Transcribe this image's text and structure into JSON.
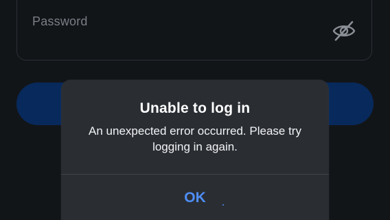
{
  "login_form": {
    "password_label": "Password",
    "visibility_icon": "eye-slash-icon"
  },
  "alert": {
    "title": "Unable to log in",
    "message": "An unexpected error occurred. Please try logging in again.",
    "ok_label": "OK"
  },
  "colors": {
    "background": "#121518",
    "button": "#0d3f8c",
    "alert_background": "#2a2e33",
    "accent": "#4f8ef7"
  }
}
